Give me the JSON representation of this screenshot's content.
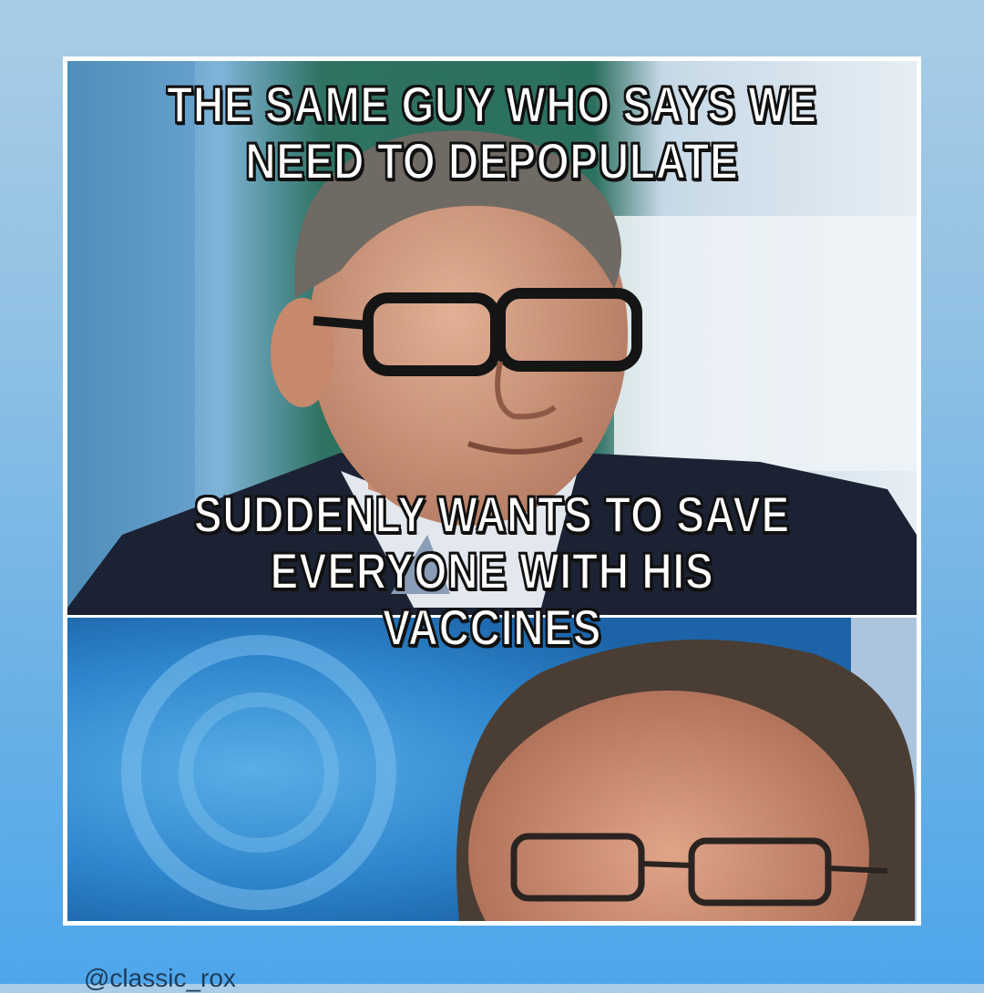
{
  "meme": {
    "top_caption": [
      "THE SAME GUY WHO SAYS WE",
      "NEED TO DEPOPULATE"
    ],
    "bottom_caption": [
      "SUDDENLY WANTS TO SAVE",
      "EVERYONE WITH HIS",
      "VACCINES"
    ]
  },
  "post": {
    "handle": "@classic_rox"
  },
  "colors": {
    "background_top": "#a9cde6",
    "background_bottom": "#4ea6ea",
    "frame": "#ffffff",
    "caption_fill": "#ffffff",
    "caption_outline": "#111111"
  }
}
